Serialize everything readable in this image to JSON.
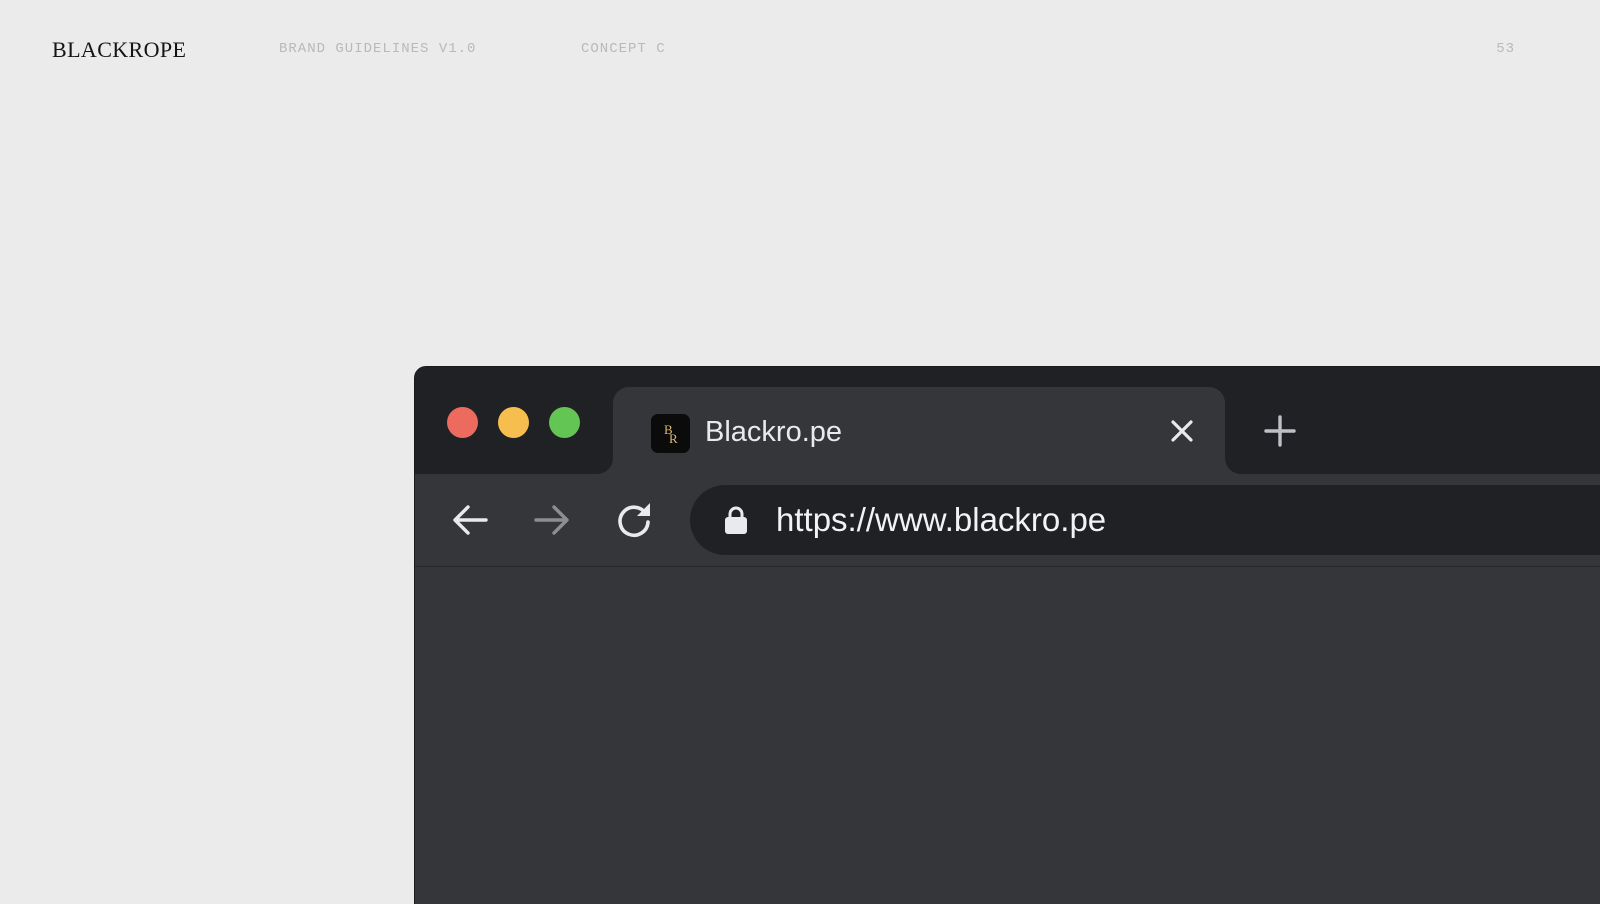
{
  "header": {
    "brand": "BLACKROPE",
    "guidelines": "BRAND GUIDELINES V1.0",
    "concept": "CONCEPT C",
    "page_number": "53"
  },
  "browser": {
    "tab": {
      "favicon_letters": [
        "B",
        "R"
      ],
      "title": "Blackro.pe"
    },
    "omnibox": {
      "url": "https://www.blackro.pe"
    },
    "icons": {
      "tab_close": "close-icon",
      "new_tab": "plus-icon",
      "back": "arrow-left-icon",
      "forward": "arrow-right-icon",
      "reload": "reload-icon",
      "secure": "lock-icon"
    }
  },
  "colors": {
    "page_background": "#ebebeb",
    "tab_strip": "#202124",
    "toolbar": "#35363a",
    "omnibox": "#202124",
    "traffic_close": "#ed6a5e",
    "traffic_minimize": "#f5be4f",
    "traffic_maximize": "#62c554",
    "favicon_gold": "#d9b978"
  }
}
